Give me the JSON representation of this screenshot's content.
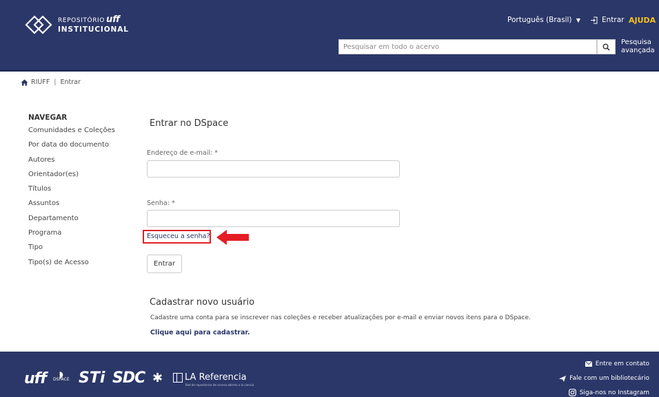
{
  "header": {
    "logo_line1": "REPOSITÓRIO",
    "logo_uff": "uff",
    "logo_line2": "INSTITUCIONAL",
    "language": "Português (Brasil)",
    "login_label": "Entrar",
    "help_label": "AJUDA",
    "search_placeholder": "Pesquisar em todo o acervo",
    "advanced_line1": "Pesquisa",
    "advanced_line2": "avançada"
  },
  "breadcrumb": {
    "home": "RIUFF",
    "current": "Entrar"
  },
  "sidebar": {
    "title": "NAVEGAR",
    "items": [
      "Comunidades e Coleções",
      "Por data do documento",
      "Autores",
      "Orientador(es)",
      "Títulos",
      "Assuntos",
      "Departamento",
      "Programa",
      "Tipo",
      "Tipo(s) de Acesso"
    ]
  },
  "login": {
    "title": "Entrar no DSpace",
    "email_label": "Endereço de e-mail: *",
    "password_label": "Senha: *",
    "forgot_link": "Esqueceu a senha?",
    "submit_label": "Entrar"
  },
  "register": {
    "title": "Cadastrar novo usuário",
    "description": "Cadastre uma conta para se inscrever nas coleções e receber atualizações por e-mail e enviar novos itens para o DSpace.",
    "link": "Clique aqui para cadastrar."
  },
  "footer": {
    "logo_uff": "uff",
    "logo_dspace": "DSPACE",
    "logo_sti": "STi",
    "logo_sdc": "SDC",
    "logo_la": "LA Referencia",
    "logo_la_sub": "Red de repositorios de acceso abierto a la ciencia",
    "contact": "Entre em contato",
    "librarian": "Fale com um bibliotecário",
    "instagram": "Siga-nos no Instagram"
  },
  "colors": {
    "header_bg": "#2b3768",
    "help_accent": "#f5c21b",
    "highlight_red": "#e51e25"
  }
}
